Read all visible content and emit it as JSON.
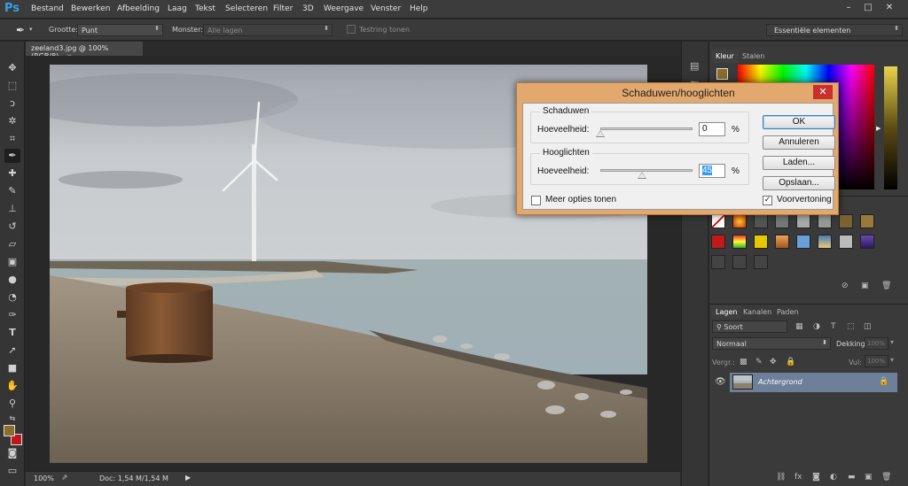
{
  "app": {
    "logo": "Ps"
  },
  "menu": [
    "Bestand",
    "Bewerken",
    "Afbeelding",
    "Laag",
    "Tekst",
    "Selecteren",
    "Filter",
    "3D",
    "Weergave",
    "Venster",
    "Help"
  ],
  "window_controls": [
    "–",
    "□",
    "✕"
  ],
  "options": {
    "size_label": "Grootte:",
    "size_value": "Punt",
    "sample_label": "Monster:",
    "sample_value": "Alle lagen",
    "ring_label": "Testring tonen",
    "workspace": "Essentiële elementen"
  },
  "document": {
    "tab_title": "zeeland3.jpg @ 100% (RGB/8)",
    "zoom": "100%",
    "doc_info": "Doc: 1,54 M/1,54 M"
  },
  "panels": {
    "color_tabs": [
      "Kleur",
      "Stalen"
    ],
    "layers_tabs": [
      "Lagen",
      "Kanalen",
      "Paden"
    ],
    "filter_kind": "Soort",
    "blend_mode": "Normaal",
    "opacity_label": "Dekking:",
    "opacity_value": "100%",
    "lock_label": "Vergr.:",
    "fill_label": "Vul:",
    "fill_value": "100%",
    "layer_name": "Achtergrond"
  },
  "colors": {
    "foreground": "#8a6d2a",
    "background": "#c0151a",
    "dialog_frame": "#e3a86e",
    "accent": "#3399ff"
  },
  "dialog": {
    "title": "Schaduwen/hooglichten",
    "close": "✕",
    "shadows_group": "Schaduwen",
    "shadows_amount_label": "Hoeveelheid:",
    "shadows_amount_value": "0",
    "shadows_amount_fraction": 0.0,
    "highlights_group": "Hooglichten",
    "highlights_amount_label": "Hoeveelheid:",
    "highlights_amount_value": "45",
    "highlights_amount_fraction": 0.45,
    "percent": "%",
    "more_options_label": "Meer opties tonen",
    "more_options_checked": false,
    "preview_label": "Voorvertoning",
    "preview_checked": true,
    "buttons": {
      "ok": "OK",
      "cancel": "Annuleren",
      "load": "Laden...",
      "save": "Opslaan..."
    }
  }
}
